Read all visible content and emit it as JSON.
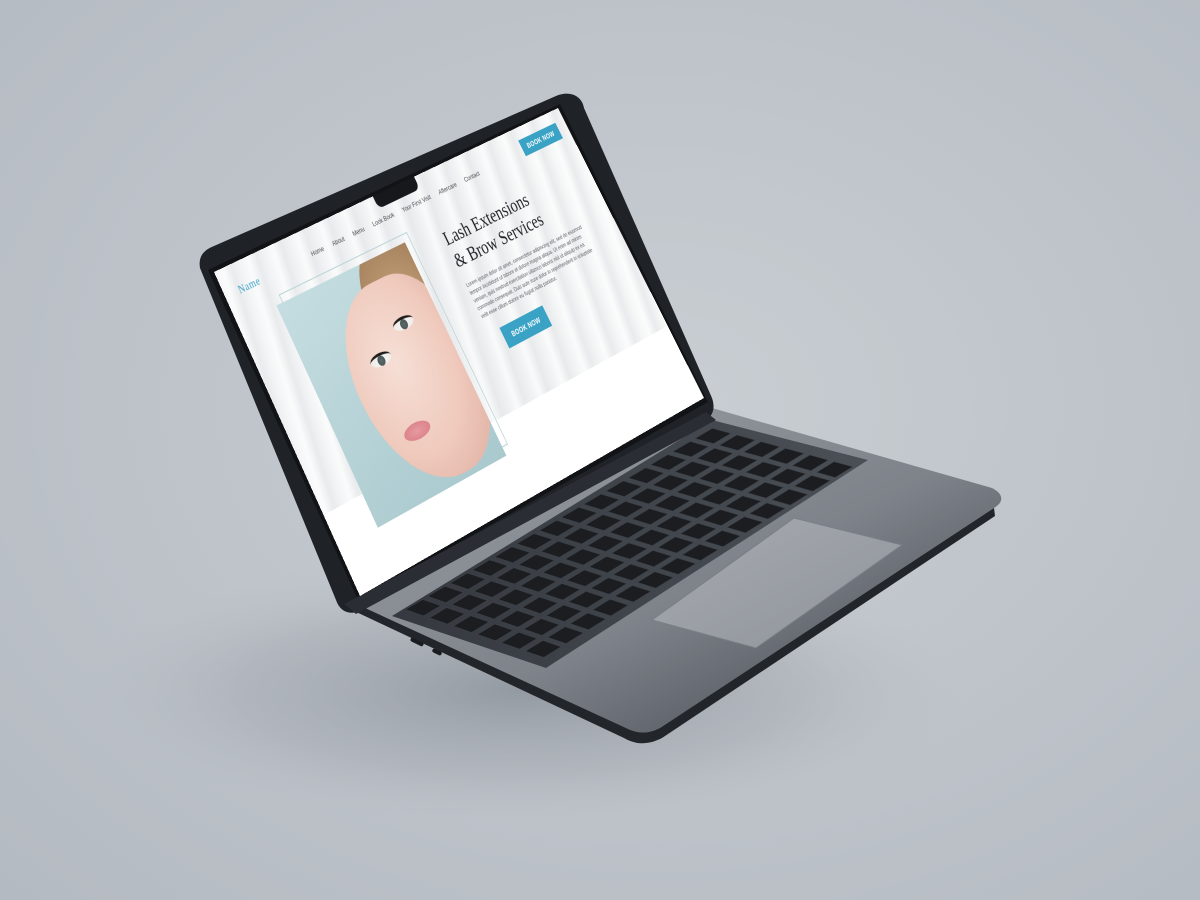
{
  "site": {
    "brand": "Name",
    "nav": [
      "Home",
      "About",
      "Menu",
      "Look Book",
      "Your First Visit",
      "Aftercare",
      "Contact"
    ],
    "nav_cta": "BOOK NOW",
    "hero": {
      "headline_line1": "Lash Extensions",
      "headline_line2": "& Brow Services",
      "body": "Lorem ipsum dolor sit amet, consectetur adipiscing elit, sed do eiusmod tempor incididunt ut labore et dolore magna aliqua. Ut enim ad minim veniam, quis nostrud exercitation ullamco laboris nisi ut aliquip ex ea commodo consequat. Duis aute irure dolor in reprehenderit in voluptate velit esse cillum dolore eu fugiat nulla pariatur.",
      "cta": "BOOK NOW"
    }
  },
  "colors": {
    "accent": "#3aa2c5",
    "background": "#bcc2c8",
    "laptop_body": "#2b2f36"
  }
}
